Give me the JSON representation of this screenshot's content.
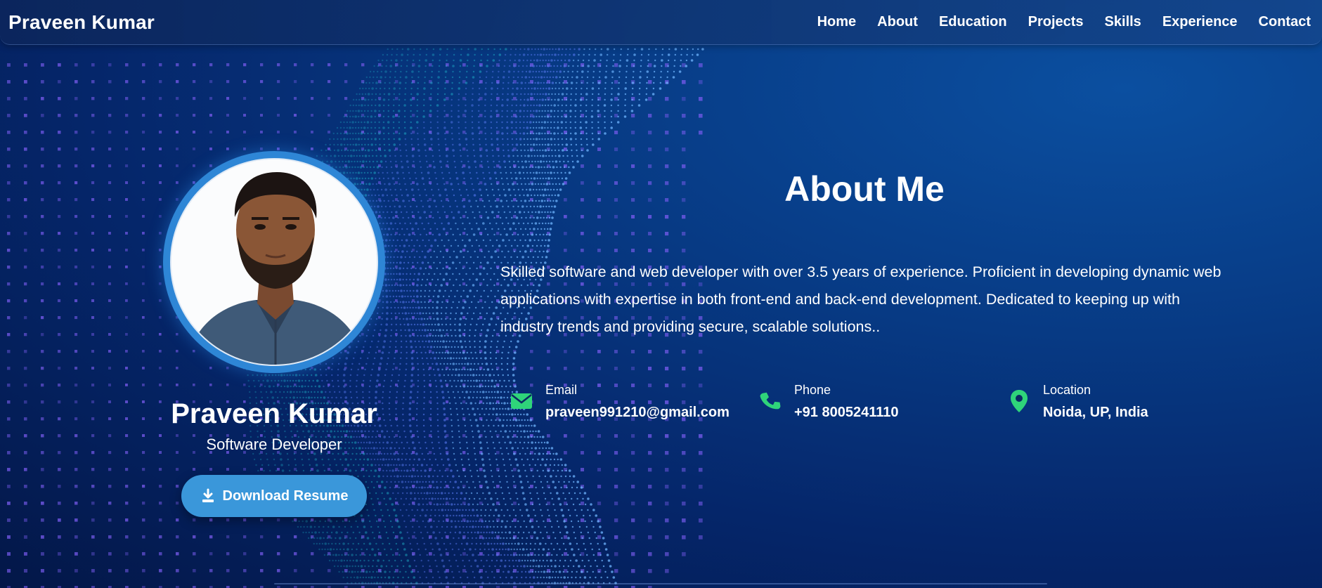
{
  "navbar": {
    "brand": "Praveen Kumar",
    "links": [
      "Home",
      "About",
      "Education",
      "Projects",
      "Skills",
      "Experience",
      "Contact"
    ]
  },
  "profile": {
    "name": "Praveen Kumar",
    "role": "Software Developer",
    "resume_button": "Download Resume",
    "photo_icon": "profile-photo"
  },
  "about": {
    "title": "About Me",
    "text": "Skilled software and web developer with over 3.5 years of experience. Proficient in developing dynamic web applications with expertise in both front-end and back-end development. Dedicated to keeping up with industry trends and providing secure, scalable solutions.."
  },
  "contacts": [
    {
      "label": "Email",
      "value": "praveen991210@gmail.com",
      "icon": "envelope-icon"
    },
    {
      "label": "Phone",
      "value": "+91 8005241110",
      "icon": "phone-icon"
    },
    {
      "label": "Location",
      "value": "Noida, UP, India",
      "icon": "map-pin-icon"
    }
  ],
  "colors": {
    "accent": "#3a97da",
    "icon_green": "#2fd47a",
    "background": "#05266a"
  }
}
